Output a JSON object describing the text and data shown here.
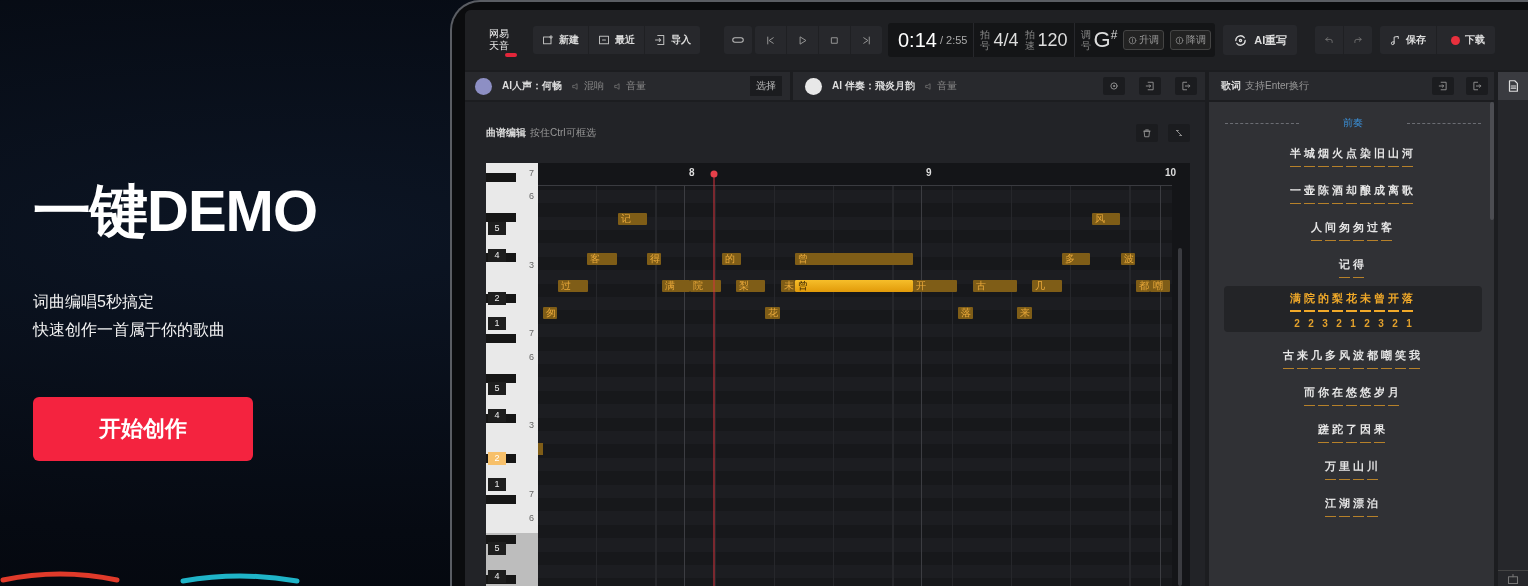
{
  "hero": {
    "title": "一键DEMO",
    "subtitle_lines": [
      "词曲编唱5秒搞定",
      "快速创作一首属于你的歌曲"
    ],
    "cta": "开始创作"
  },
  "toolbar": {
    "logo": [
      "网易",
      "天音"
    ],
    "file_buttons": [
      "新建",
      "最近",
      "导入"
    ],
    "time": {
      "current": "0:14",
      "total": "/ 2:55"
    },
    "meter": {
      "label": "拍号",
      "value": "4/4"
    },
    "tempo": {
      "label": "拍速",
      "value": "120"
    },
    "key": {
      "label": "调号",
      "value": "G",
      "accidental": "#"
    },
    "key_buttons": [
      "升调",
      "降调"
    ],
    "rewrite": "AI重写",
    "save": "保存",
    "download": "下载"
  },
  "tracks": [
    {
      "label": "AI人声：何畅",
      "effects": [
        "混响",
        "音量"
      ],
      "button": "选择"
    },
    {
      "label": "AI 伴奏：飛炎月韵",
      "effects": [
        "音量"
      ]
    }
  ],
  "editor": {
    "title": "曲谱编辑",
    "hint": "按住Ctrl可框选",
    "bars": [
      "8",
      "9",
      "10"
    ],
    "keys": [
      {
        "label": "7",
        "kind": "white",
        "selected": false
      },
      {
        "label": "6",
        "kind": "white",
        "selected": false
      },
      {
        "label": "5",
        "kind": "tag",
        "selected": false
      },
      {
        "label": "4",
        "kind": "tag",
        "selected": false
      },
      {
        "label": "3",
        "kind": "white",
        "selected": false
      },
      {
        "label": "2",
        "kind": "tag",
        "selected": false
      },
      {
        "label": "1",
        "kind": "tag",
        "selected": false
      },
      {
        "label": "7",
        "kind": "white",
        "selected": false
      },
      {
        "label": "6",
        "kind": "white",
        "selected": false
      },
      {
        "label": "5",
        "kind": "tag",
        "selected": false
      },
      {
        "label": "4",
        "kind": "tag",
        "selected": false
      },
      {
        "label": "3",
        "kind": "white",
        "selected": false
      },
      {
        "label": "2",
        "kind": "tag",
        "selected": true
      },
      {
        "label": "1",
        "kind": "tag",
        "selected": false
      },
      {
        "label": "7",
        "kind": "white",
        "selected": false
      },
      {
        "label": "6",
        "kind": "white",
        "selected": false
      },
      {
        "label": "5",
        "kind": "tag",
        "selected": false
      },
      {
        "label": "4",
        "kind": "tag",
        "selected": false
      }
    ],
    "notes": [
      {
        "text": "匆",
        "selected": false
      },
      {
        "text": "过",
        "selected": false
      },
      {
        "text": "客",
        "selected": false
      },
      {
        "text": "记",
        "selected": false
      },
      {
        "text": "得",
        "selected": false
      },
      {
        "text": "满",
        "selected": false
      },
      {
        "text": "院",
        "selected": false
      },
      {
        "text": "的",
        "selected": false
      },
      {
        "text": "梨",
        "selected": false
      },
      {
        "text": "花",
        "selected": false
      },
      {
        "text": "未",
        "selected": false
      },
      {
        "text": "曾",
        "selected": false
      },
      {
        "text": "曾",
        "selected": true
      },
      {
        "text": "开",
        "selected": false
      },
      {
        "text": "落",
        "selected": false
      },
      {
        "text": "古",
        "selected": false
      },
      {
        "text": "来",
        "selected": false
      },
      {
        "text": "几",
        "selected": false
      },
      {
        "text": "多",
        "selected": false
      },
      {
        "text": "风",
        "selected": false
      },
      {
        "text": "波",
        "selected": false
      },
      {
        "text": "都",
        "selected": false
      },
      {
        "text": "嘲",
        "selected": false
      }
    ]
  },
  "lyrics": {
    "title": "歌词",
    "hint": "支持Enter换行",
    "section": "前奏",
    "lines": [
      {
        "text": "半城烟火点染旧山河",
        "selected": false
      },
      {
        "text": "一壶陈酒却酿成离歌",
        "selected": false
      },
      {
        "text": "人间匆匆过客",
        "selected": false
      },
      {
        "text": "记得",
        "selected": false
      },
      {
        "text": "满院的梨花未曾开落",
        "selected": true,
        "notation": [
          "2",
          "2",
          "3",
          "2",
          "1",
          "2",
          "3",
          "2",
          "1"
        ]
      },
      {
        "text": "古来几多风波都嘲笑我",
        "selected": false
      },
      {
        "text": "而你在悠悠岁月",
        "selected": false
      },
      {
        "text": "蹉跎了因果",
        "selected": false
      },
      {
        "text": "万里山川",
        "selected": false
      },
      {
        "text": "江湖漂泊",
        "selected": false
      }
    ]
  }
}
